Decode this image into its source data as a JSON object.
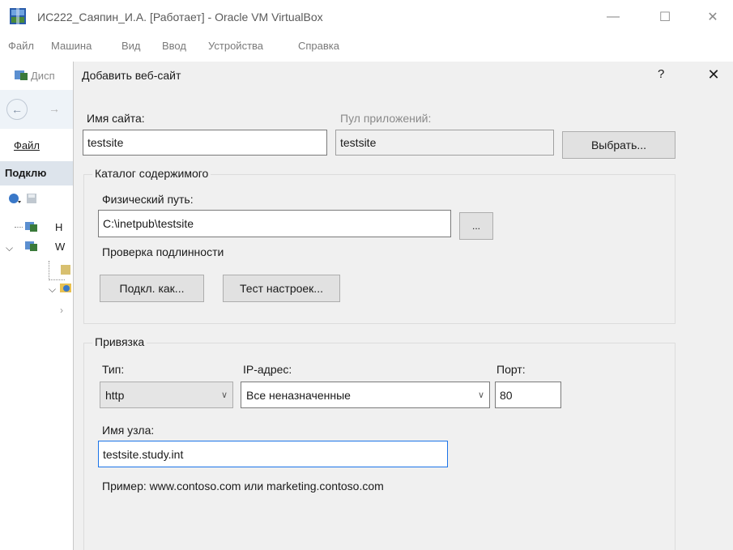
{
  "window": {
    "title": "ИС222_Саяпин_И.А. [Работает] - Oracle VM VirtualBox",
    "minimize_glyph": "—",
    "maximize_glyph": "☐",
    "close_glyph": "✕"
  },
  "menu": [
    "Файл",
    "Машина",
    "Вид",
    "Ввод",
    "Устройства",
    "Справка"
  ],
  "guest": {
    "title_fragment": "Дисп",
    "menu_fragment": "Файл",
    "panel_fragment": "Подклю",
    "tree_fragment_1": "Н",
    "tree_fragment_2": "W"
  },
  "dialog": {
    "title": "Добавить веб-сайт",
    "help_glyph": "?",
    "close_glyph": "✕",
    "site_name_label": "Имя сайта:",
    "site_name_value": "testsite",
    "app_pool_label": "Пул приложений:",
    "app_pool_value": "testsite",
    "select_button": "Выбрать...",
    "content_group": "Каталог содержимого",
    "physical_path_label": "Физический путь:",
    "physical_path_value": "C:\\inetpub\\testsite",
    "browse_button": "...",
    "auth_label": "Проверка подлинности",
    "connect_as_button": "Подкл. как...",
    "test_settings_button": "Тест настроек...",
    "binding_group": "Привязка",
    "type_label": "Тип:",
    "type_value": "http",
    "ip_label": "IP-адрес:",
    "ip_value": "Все неназначенные",
    "port_label": "Порт:",
    "port_value": "80",
    "host_label": "Имя узла:",
    "host_value": "testsite.study.int",
    "example_text": "Пример: www.contoso.com или marketing.contoso.com"
  },
  "colors": {
    "focus_border": "#1a73e8",
    "dialog_bg": "#f0f0f0"
  }
}
